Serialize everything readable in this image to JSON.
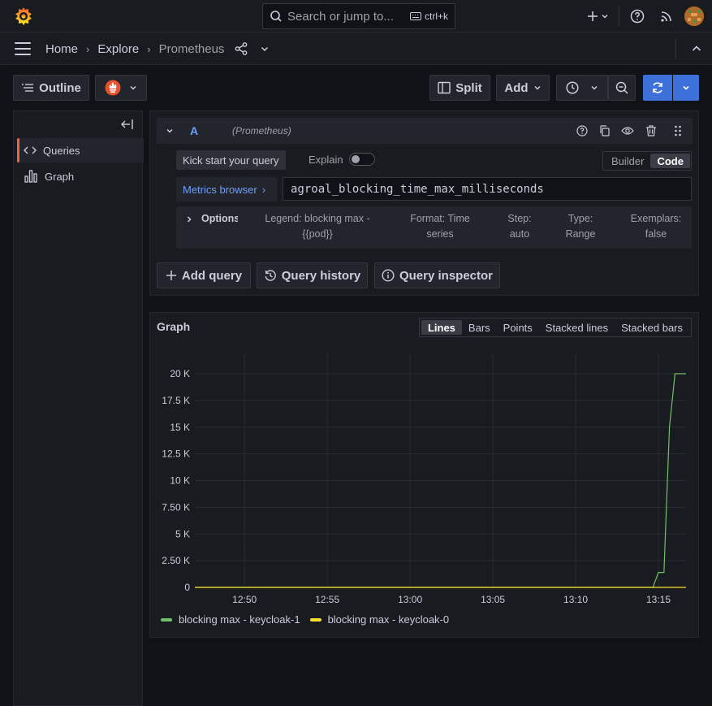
{
  "topbar": {
    "search_placeholder": "Search or jump to...",
    "shortcut": "ctrl+k"
  },
  "breadcrumb": {
    "home": "Home",
    "explore": "Explore",
    "current": "Prometheus"
  },
  "toolbar": {
    "outline": "Outline",
    "split": "Split",
    "add": "Add"
  },
  "sidebar": {
    "items": [
      {
        "label": "Queries",
        "icon": "code-icon"
      },
      {
        "label": "Graph",
        "icon": "bar-chart-icon"
      }
    ]
  },
  "query": {
    "ref_id": "A",
    "datasource": "(Prometheus)",
    "kickstart": "Kick start your query",
    "explain": "Explain",
    "mode_builder": "Builder",
    "mode_code": "Code",
    "metrics_browser": "Metrics browser",
    "expr": "agroal_blocking_time_max_milliseconds",
    "options_label": "Options",
    "legend_line1": "Legend: blocking max -",
    "legend_line2": "{{pod}}",
    "format_line1": "Format: Time",
    "format_line2": "series",
    "step_line1": "Step:",
    "step_line2": "auto",
    "type_line1": "Type:",
    "type_line2": "Range",
    "exemplars_line1": "Exemplars:",
    "exemplars_line2": "false"
  },
  "query_actions": {
    "add_query": "Add query",
    "history": "Query history",
    "inspector": "Query inspector"
  },
  "graph": {
    "title": "Graph",
    "modes": [
      "Lines",
      "Bars",
      "Points",
      "Stacked lines",
      "Stacked bars"
    ],
    "active_mode": "Lines"
  },
  "colors": {
    "accent": "#3d71d9",
    "active_marker": "#f55f3e",
    "series_green": "#73bf69",
    "series_yellow": "#fade2a"
  },
  "chart_data": {
    "type": "line",
    "x_ticks": [
      "12:50",
      "12:55",
      "13:00",
      "13:05",
      "13:10",
      "13:15"
    ],
    "y_ticks": [
      "0",
      "2.50 K",
      "5 K",
      "7.50 K",
      "10 K",
      "12.5 K",
      "15 K",
      "17.5 K",
      "20 K"
    ],
    "ylim": [
      0,
      20000
    ],
    "x_range": [
      "12:47",
      "13:16:40"
    ],
    "grid": true,
    "legend_position": "bottom-left",
    "series": [
      {
        "name": "blocking max - keycloak-1",
        "color": "#73bf69",
        "points": [
          [
            "12:47",
            0
          ],
          [
            "13:14:40",
            0
          ],
          [
            "13:15:00",
            1400
          ],
          [
            "13:15:20",
            1400
          ],
          [
            "13:15:40",
            15000
          ],
          [
            "13:16:00",
            20000
          ],
          [
            "13:16:40",
            20000
          ]
        ]
      },
      {
        "name": "blocking max - keycloak-0",
        "color": "#fade2a",
        "points": [
          [
            "12:47",
            0
          ],
          [
            "13:16:40",
            0
          ]
        ]
      }
    ]
  }
}
